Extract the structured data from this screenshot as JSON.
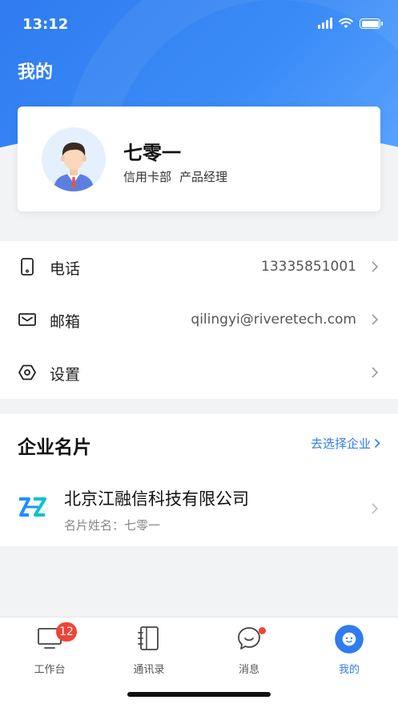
{
  "status_bar": {
    "time": "13:12"
  },
  "header": {
    "title": "我的"
  },
  "profile": {
    "name": "七零一",
    "department": "信用卡部",
    "position": "产品经理"
  },
  "info_list": [
    {
      "label": "电话",
      "value": "13335851001",
      "icon": "phone-icon"
    },
    {
      "label": "邮箱",
      "value": "qilingyi@riveretech.com",
      "icon": "mail-icon"
    },
    {
      "label": "设置",
      "value": "",
      "icon": "settings-icon"
    }
  ],
  "company_section": {
    "title": "企业名片",
    "select_label": "去选择企业",
    "company_name": "北京江融信科技有限公司",
    "card_name": "名片姓名：七零一"
  },
  "tab_bar": {
    "tabs": [
      {
        "label": "工作台",
        "badge": "12",
        "icon": "monitor-icon"
      },
      {
        "label": "通讯录",
        "icon": "contacts-book-icon"
      },
      {
        "label": "消息",
        "icon": "chat-bubble-icon"
      },
      {
        "label": "我的",
        "icon": "profile-face-icon",
        "active": true
      }
    ]
  },
  "colors": {
    "accent": "#2f7bf0",
    "badge": "#f04438"
  }
}
